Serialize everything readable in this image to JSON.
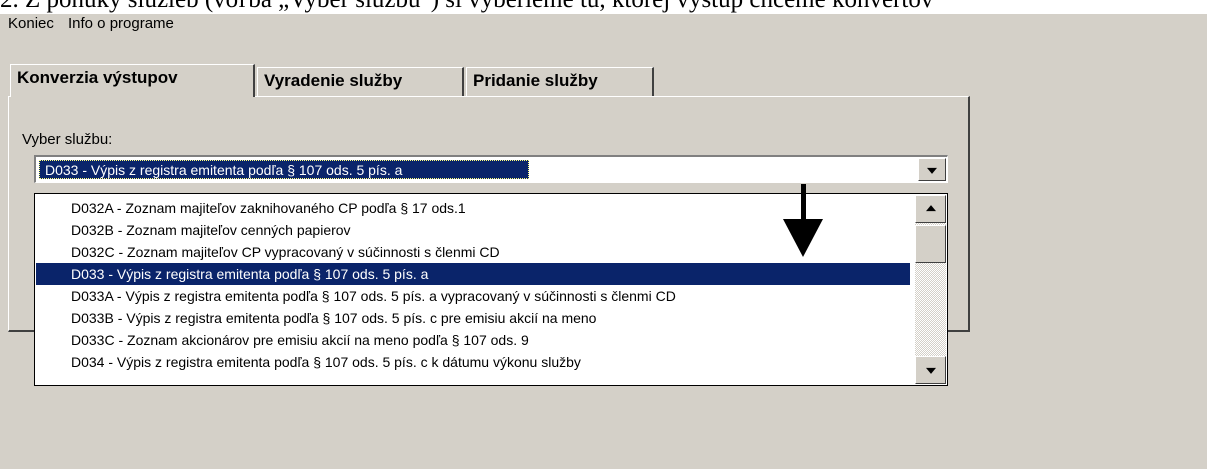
{
  "caption": "2. Z ponuky služieb (voľba „Vyber službu\") si vyberieme tú, ktorej výstup chceme konvertov",
  "menubar": {
    "items": [
      "Koniec",
      "Info o programe"
    ]
  },
  "tabs": [
    "Konverzia výstupov",
    "Vyradenie služby",
    "Pridanie služby"
  ],
  "form": {
    "label": "Vyber službu:",
    "selected_value": "D033 - Výpis z registra emitenta podľa § 107 ods. 5 pís. a"
  },
  "dropdown": {
    "items": [
      "D032A - Zoznam majiteľov zaknihovaného CP podľa § 17 ods.1",
      "D032B - Zoznam majiteľov cenných papierov",
      "D032C - Zoznam majiteľov CP vypracovaný v súčinnosti s členmi CD",
      "D033 - Výpis z registra emitenta podľa § 107 ods. 5 pís. a",
      "D033A -  Výpis z registra emitenta podľa § 107 ods. 5 pís. a vypracovaný v súčinnosti s členmi CD",
      "D033B - Výpis z registra emitenta podľa § 107 ods. 5 pís. c pre emisiu akcií na meno",
      "D033C -  Zoznam akcionárov pre emisiu akcií na meno podľa § 107 ods. 9",
      "D034 - Výpis z registra emitenta podľa § 107 ods. 5 pís. c k dátumu výkonu služby"
    ],
    "selected_index": 3
  },
  "colors": {
    "window_bg": "#d4d0c8",
    "selection": "#0a246a"
  },
  "icons": [
    "dropdown-arrow-icon",
    "scroll-up-icon",
    "scroll-down-icon",
    "annotation-arrow-icon"
  ]
}
